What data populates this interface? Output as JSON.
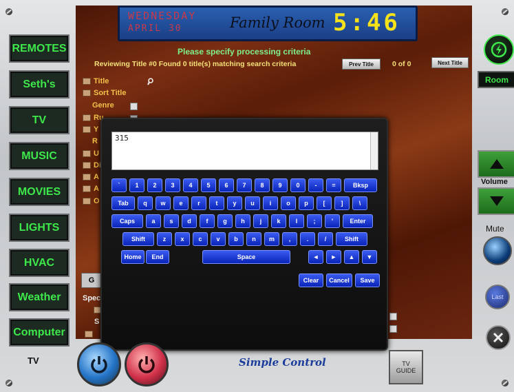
{
  "lcd": {
    "day": "WEDNESDAY",
    "date": "APRIL 30",
    "room": "Family Room",
    "time": "5:46"
  },
  "sidebar": {
    "items": [
      {
        "label": "REMOTES"
      },
      {
        "label": "Seth's"
      },
      {
        "label": "TV"
      },
      {
        "label": "MUSIC"
      },
      {
        "label": "MOVIES"
      },
      {
        "label": "LIGHTS"
      },
      {
        "label": "HVAC"
      },
      {
        "label": "Weather"
      },
      {
        "label": "Computer"
      }
    ]
  },
  "bottom": {
    "current": "TV",
    "guide_line1": "TV",
    "guide_line2": "GUIDE",
    "logo": "Simple Control"
  },
  "right": {
    "room_label": "Room",
    "volume_label": "Volume",
    "mute_label": "Mute",
    "last_label": "Last"
  },
  "panel": {
    "title": "Please specify processing criteria",
    "status": "Reviewing Title #0  Found 0 title(s) matching search criteria",
    "prev": "Prev Title",
    "count": "0 of 0",
    "next": "Next Title",
    "fields": [
      "Title",
      "Sort Title",
      "Genre",
      "Ru",
      "Y",
      "R",
      "U",
      "Di",
      "A",
      "A",
      "O"
    ],
    "spec_label": "Spec",
    "s_label": "S",
    "g_label": "G"
  },
  "keyboard": {
    "text": "315",
    "row1": [
      "`",
      "1",
      "2",
      "3",
      "4",
      "5",
      "6",
      "7",
      "8",
      "9",
      "0",
      "-",
      "=",
      "Bksp"
    ],
    "row2": [
      "Tab",
      "q",
      "w",
      "e",
      "r",
      "t",
      "y",
      "u",
      "i",
      "o",
      "p",
      "[",
      "]",
      "\\"
    ],
    "row3": [
      "Caps",
      "a",
      "s",
      "d",
      "f",
      "g",
      "h",
      "j",
      "k",
      "l",
      ";",
      "'",
      "Enter"
    ],
    "row4": [
      "Shift",
      "z",
      "x",
      "c",
      "v",
      "b",
      "n",
      "m",
      ",",
      ".",
      "/",
      "Shift"
    ],
    "row5": [
      "Home",
      "End",
      "Space",
      "◄",
      "►",
      "▲",
      "▼"
    ],
    "actions": [
      "Clear",
      "Cancel",
      "Save"
    ]
  },
  "colors": {
    "accent": "#3ee84a",
    "key": "#1f3fd8",
    "lcd_time": "#f6e21a"
  }
}
